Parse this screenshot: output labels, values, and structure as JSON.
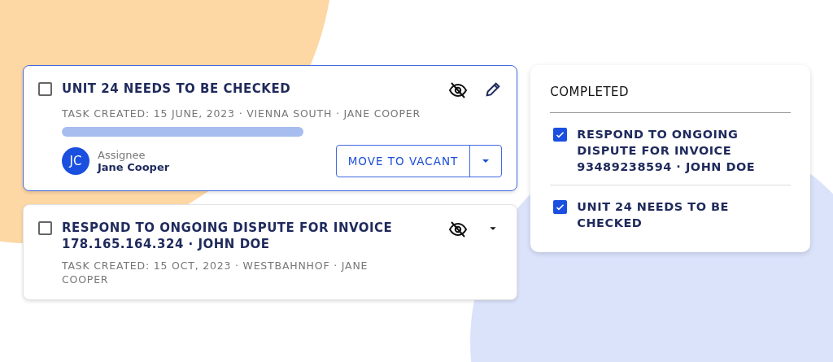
{
  "tasks": [
    {
      "title": "UNIT 24 NEEDS TO BE CHECKED",
      "meta": "TASK CREATED: 15 JUNE, 2023 · VIENNA SOUTH · JANE COOPER",
      "checked": false,
      "selected": true,
      "expanded": true,
      "assignee": {
        "initials": "JC",
        "label": "Assignee",
        "name": "Jane Cooper"
      },
      "action": "MOVE TO VACANT"
    },
    {
      "title": "RESPOND TO ONGOING DISPUTE FOR INVOICE 178.165.164.324 · JOHN DOE",
      "meta": "TASK CREATED: 15 OCT, 2023 · WESTBAHNHOF · JANE COOPER",
      "checked": false,
      "selected": false,
      "expanded": false
    }
  ],
  "completed": {
    "title": "COMPLETED",
    "items": [
      {
        "label": "RESPOND TO ONGOING DISPUTE FOR INVOICE 93489238594 · JOHN DOE",
        "checked": true
      },
      {
        "label": "UNIT 24 NEEDS TO BE CHECKED",
        "checked": true
      }
    ]
  }
}
